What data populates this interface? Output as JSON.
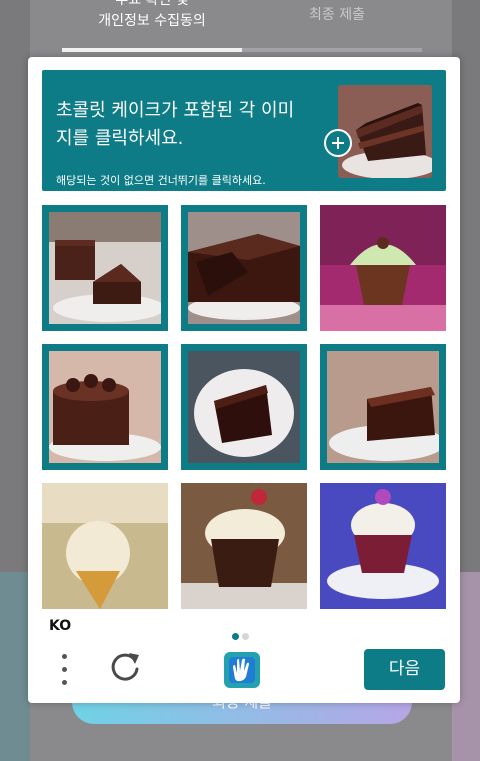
{
  "background": {
    "tab_step1_line1": "투표 확인 및",
    "tab_step1_line2": "개인정보 수집동의",
    "tab_step2": "최종 제출",
    "step_progress_fraction": 0.5,
    "submit_button": "최종 제출"
  },
  "captcha": {
    "prompt_title": "초콜릿 케이크가 포함된 각 이미지를 클릭하세요.",
    "prompt_subtitle": "해당되는 것이 없으면 건너뛰기를 클릭하세요.",
    "example_icon": "chocolate-cake-slice",
    "tiles": [
      {
        "subject": "chocolate cake slices on plate",
        "selected": true
      },
      {
        "subject": "chocolate cake",
        "selected": true
      },
      {
        "subject": "cupcake with green frosting",
        "selected": false
      },
      {
        "subject": "chocolate cake",
        "selected": true
      },
      {
        "subject": "chocolate cake slice on plate",
        "selected": true
      },
      {
        "subject": "chocolate cake slice",
        "selected": true
      },
      {
        "subject": "ice cream cone",
        "selected": false
      },
      {
        "subject": "cupcake with cream and berry",
        "selected": false
      },
      {
        "subject": "cupcake with purple flower",
        "selected": false
      }
    ],
    "language": "KO",
    "page_indicator": {
      "current": 1,
      "total": 2
    },
    "menu_icon": "vertical-dots-icon",
    "refresh_icon": "refresh-icon",
    "logo_icon": "hcaptcha-hand-logo",
    "next_button": "다음",
    "accent_color": "#0e7c87"
  }
}
